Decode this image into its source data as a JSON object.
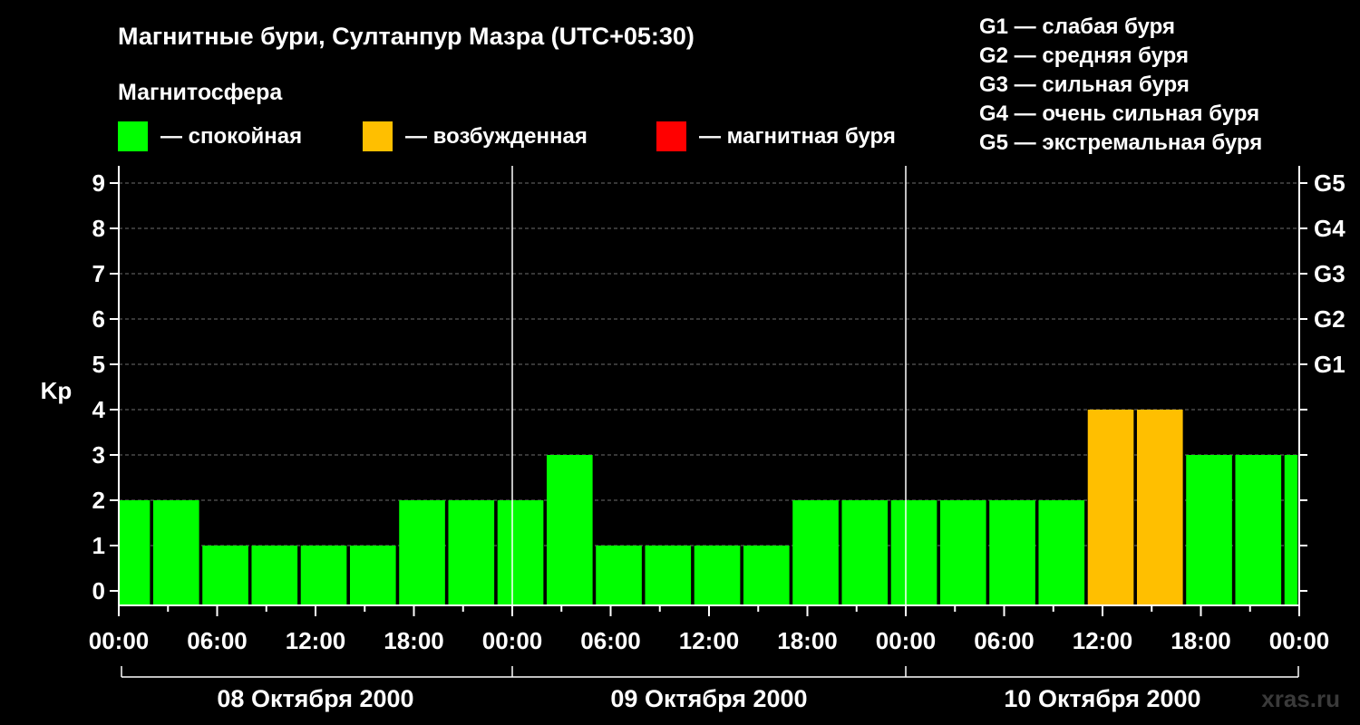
{
  "chart_data": {
    "type": "bar",
    "title": "Магнитные бури, Султанпур Мазра (UTC+05:30)",
    "ylabel": "Kp",
    "ylim": [
      0,
      9
    ],
    "yticks": [
      0,
      1,
      2,
      3,
      4,
      5,
      6,
      7,
      8,
      9
    ],
    "right_ticks": [
      {
        "value": 5,
        "label": "G1"
      },
      {
        "value": 6,
        "label": "G2"
      },
      {
        "value": 7,
        "label": "G3"
      },
      {
        "value": 8,
        "label": "G4"
      },
      {
        "value": 9,
        "label": "G5"
      }
    ],
    "x_tick_labels": [
      "00:00",
      "06:00",
      "12:00",
      "18:00",
      "00:00",
      "06:00",
      "12:00",
      "18:00",
      "00:00",
      "06:00",
      "12:00",
      "18:00",
      "00:00"
    ],
    "x_tick_hours": [
      0,
      6,
      12,
      18,
      24,
      30,
      36,
      42,
      48,
      54,
      60,
      66,
      72
    ],
    "dates": [
      "08 Октября 2000",
      "09 Октября 2000",
      "10 Октября 2000"
    ],
    "grid": true,
    "bars": [
      {
        "start": 0,
        "end": 1.9,
        "kp": 2,
        "level": "quiet"
      },
      {
        "start": 2.1,
        "end": 4.9,
        "kp": 2,
        "level": "quiet"
      },
      {
        "start": 5.1,
        "end": 7.9,
        "kp": 1,
        "level": "quiet"
      },
      {
        "start": 8.1,
        "end": 10.9,
        "kp": 1,
        "level": "quiet"
      },
      {
        "start": 11.1,
        "end": 13.9,
        "kp": 1,
        "level": "quiet"
      },
      {
        "start": 14.1,
        "end": 16.9,
        "kp": 1,
        "level": "quiet"
      },
      {
        "start": 17.1,
        "end": 19.9,
        "kp": 2,
        "level": "quiet"
      },
      {
        "start": 20.1,
        "end": 22.9,
        "kp": 2,
        "level": "quiet"
      },
      {
        "start": 23.1,
        "end": 25.9,
        "kp": 2,
        "level": "quiet"
      },
      {
        "start": 26.1,
        "end": 28.9,
        "kp": 3,
        "level": "quiet"
      },
      {
        "start": 29.1,
        "end": 31.9,
        "kp": 1,
        "level": "quiet"
      },
      {
        "start": 32.1,
        "end": 34.9,
        "kp": 1,
        "level": "quiet"
      },
      {
        "start": 35.1,
        "end": 37.9,
        "kp": 1,
        "level": "quiet"
      },
      {
        "start": 38.1,
        "end": 40.9,
        "kp": 1,
        "level": "quiet"
      },
      {
        "start": 41.1,
        "end": 43.9,
        "kp": 2,
        "level": "quiet"
      },
      {
        "start": 44.1,
        "end": 46.9,
        "kp": 2,
        "level": "quiet"
      },
      {
        "start": 47.1,
        "end": 49.9,
        "kp": 2,
        "level": "quiet"
      },
      {
        "start": 50.1,
        "end": 52.9,
        "kp": 2,
        "level": "quiet"
      },
      {
        "start": 53.1,
        "end": 55.9,
        "kp": 2,
        "level": "quiet"
      },
      {
        "start": 56.1,
        "end": 58.9,
        "kp": 2,
        "level": "quiet"
      },
      {
        "start": 59.1,
        "end": 61.9,
        "kp": 4,
        "level": "active"
      },
      {
        "start": 62.1,
        "end": 64.9,
        "kp": 4,
        "level": "active"
      },
      {
        "start": 65.1,
        "end": 67.9,
        "kp": 3,
        "level": "quiet"
      },
      {
        "start": 68.1,
        "end": 70.9,
        "kp": 3,
        "level": "quiet"
      },
      {
        "start": 71.1,
        "end": 71.9,
        "kp": 3,
        "level": "quiet"
      }
    ]
  },
  "legend": {
    "title": "Магнитосфера",
    "items": [
      {
        "key": "quiet",
        "label": "— спокойная",
        "color": "#00ff00"
      },
      {
        "key": "active",
        "label": "— возбужденная",
        "color": "#ffbf00"
      },
      {
        "key": "storm",
        "label": "— магнитная буря",
        "color": "#ff0000"
      }
    ]
  },
  "g_scale": [
    "G1 — слабая буря",
    "G2 — средняя буря",
    "G3 — сильная буря",
    "G4 — очень сильная буря",
    "G5 — экстремальная буря"
  ],
  "watermark": "xras.ru"
}
